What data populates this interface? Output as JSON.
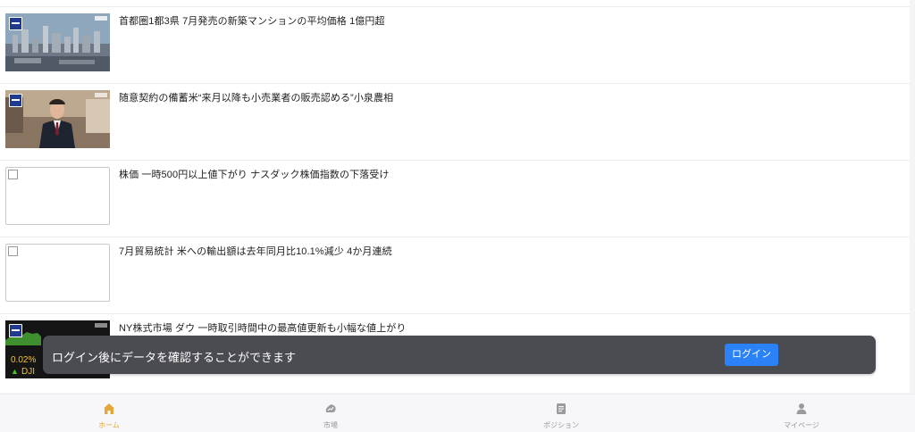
{
  "news": [
    {
      "headline": "首都圏1都3県 7月発売の新築マンションの平均価格 1億円超",
      "thumb": "city"
    },
    {
      "headline": "随意契約の備蓄米“来月以降も小売業者の販売認める”小泉農相",
      "thumb": "person"
    },
    {
      "headline": "株価 一時500円以上値下がり ナスダック株価指数の下落受け",
      "thumb": "broken"
    },
    {
      "headline": "7月貿易統計 米への輸出額は去年同月比10.1%減少 4か月連続",
      "thumb": "broken"
    },
    {
      "headline": "NY株式市場 ダウ 一時取引時間中の最高値更新も小幅な値上がり",
      "thumb": "market",
      "thumb_text": {
        "change": "0.02%",
        "index": "DJI",
        "arrow": "▲"
      }
    }
  ],
  "toast": {
    "message": "ログイン後にデータを確認することができます",
    "button": "ログイン"
  },
  "tabs": [
    {
      "label": "ホーム",
      "icon": "home-icon",
      "active": true
    },
    {
      "label": "市場",
      "icon": "market-icon",
      "active": false
    },
    {
      "label": "ポジション",
      "icon": "document-icon",
      "active": false
    },
    {
      "label": "マイページ",
      "icon": "person-icon",
      "active": false
    }
  ],
  "colors": {
    "accent": "#e2a83a",
    "inactive": "#9a9a9e",
    "button": "#2a82f6",
    "toast": "#4b4b52"
  }
}
